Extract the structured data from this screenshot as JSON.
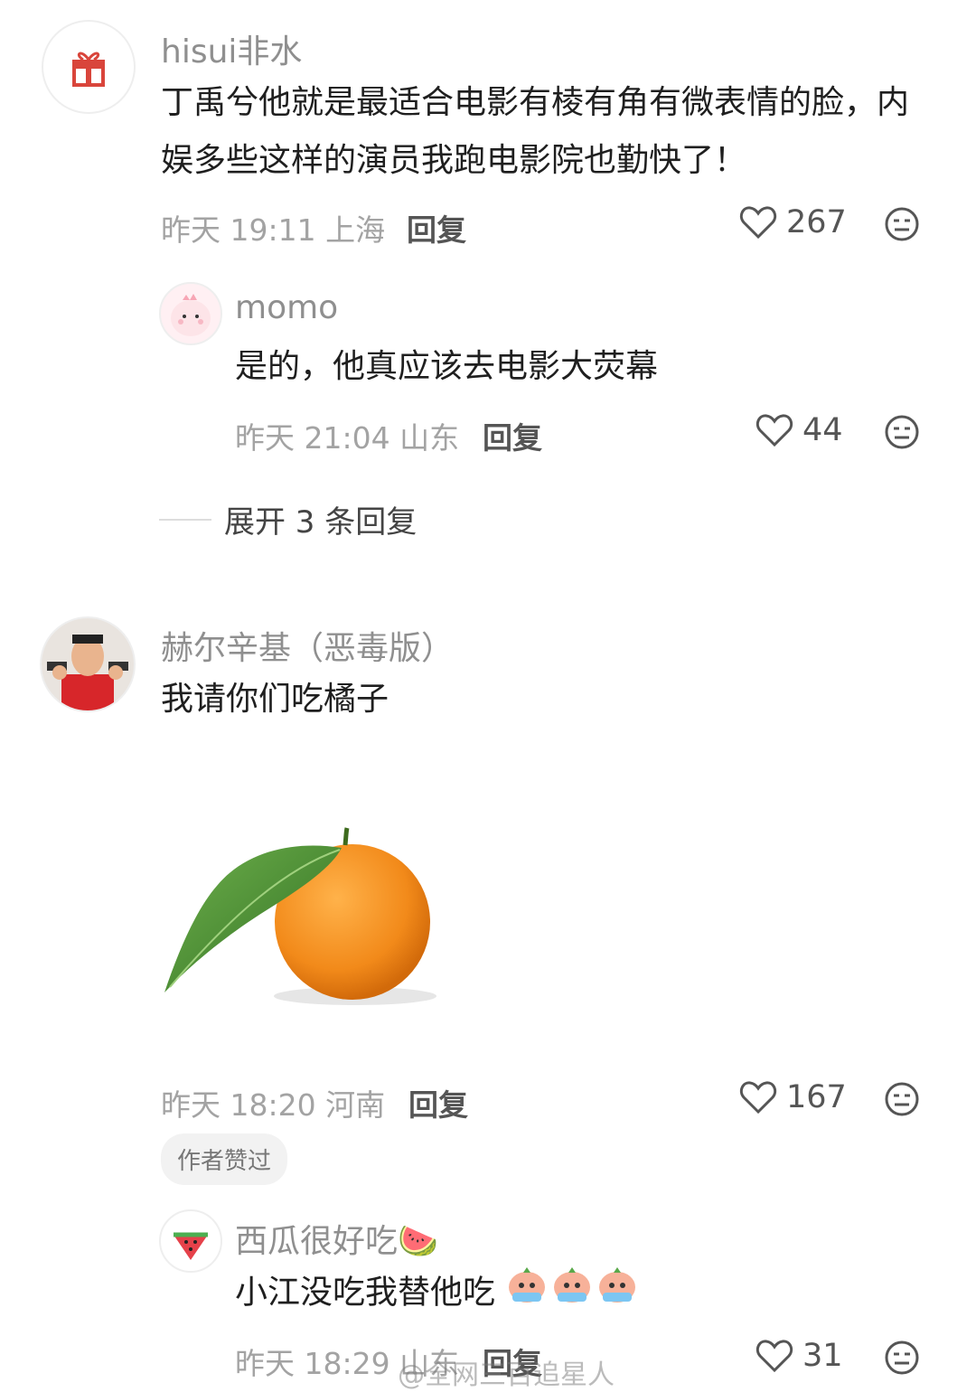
{
  "comments": [
    {
      "username": "hisui非水",
      "text": "丁禹兮他就是最适合电影有棱有角有微表情的脸，内娱多些这样的演员我跑电影院也勤快了！",
      "time": "昨天 19:11",
      "location": "上海",
      "reply_label": "回复",
      "likes": "267",
      "avatar_icon": "gift-icon",
      "replies": [
        {
          "username": "momo",
          "text": "是的，他真应该去电影大荧幕",
          "time": "昨天 21:04",
          "location": "山东",
          "reply_label": "回复",
          "likes": "44",
          "avatar_icon": "pink-dino-avatar"
        }
      ],
      "expand_label": "展开 3 条回复"
    },
    {
      "username": "赫尔辛基（恶毒版）",
      "text": "我请你们吃橘子",
      "time": "昨天 18:20",
      "location": "河南",
      "reply_label": "回复",
      "likes": "167",
      "badge": "作者赞过",
      "avatar_icon": "man-with-guns-avatar",
      "image_icon": "tangerine-image",
      "replies": [
        {
          "username": "西瓜很好吃🍉",
          "text": "小江没吃我替他吃",
          "time": "昨天 18:29",
          "location": "山东",
          "reply_label": "回复",
          "likes": "31",
          "avatar_icon": "watermelon-icon"
        }
      ]
    }
  ],
  "watermark": "@全网三百追星人",
  "colors": {
    "heart": "#555555",
    "orange": "#f28a1a",
    "leaf": "#3f8f2c"
  }
}
